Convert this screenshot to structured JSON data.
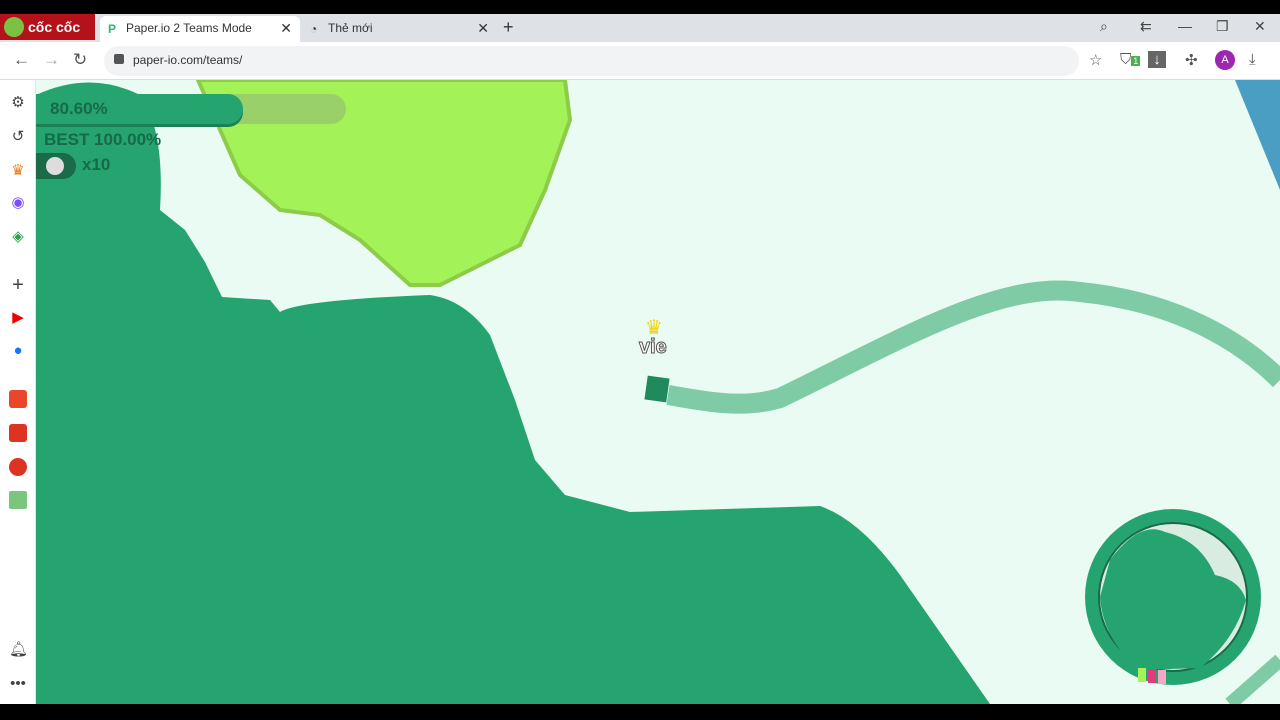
{
  "browser": {
    "brand": "cốc cốc",
    "tabs": [
      {
        "title": "Paper.io 2 Teams Mode",
        "active": true
      },
      {
        "title": "Thẻ mới",
        "active": false
      }
    ],
    "url": "paper-io.com/teams/",
    "profile_initial": "A",
    "extension_badge": "1"
  },
  "sidebar": {
    "icons": [
      "gear-icon",
      "history-icon",
      "crown-icon",
      "messenger-icon",
      "gamepad-icon",
      "plus-icon",
      "youtube-icon",
      "facebook-icon",
      "shopee-icon",
      "tiki-icon",
      "game-icon",
      "sheet-icon",
      "bell-icon",
      "more-icon"
    ]
  },
  "game": {
    "progress_text": "80.60%",
    "progress": 80.6,
    "best_text": "BEST 100.00%",
    "kills_text": "x10",
    "player_name": "vie",
    "colors": {
      "territory": "#26a46f",
      "enemy": "#a3f257",
      "trail": "#7ecba5",
      "background": "#e9fbf2"
    }
  }
}
